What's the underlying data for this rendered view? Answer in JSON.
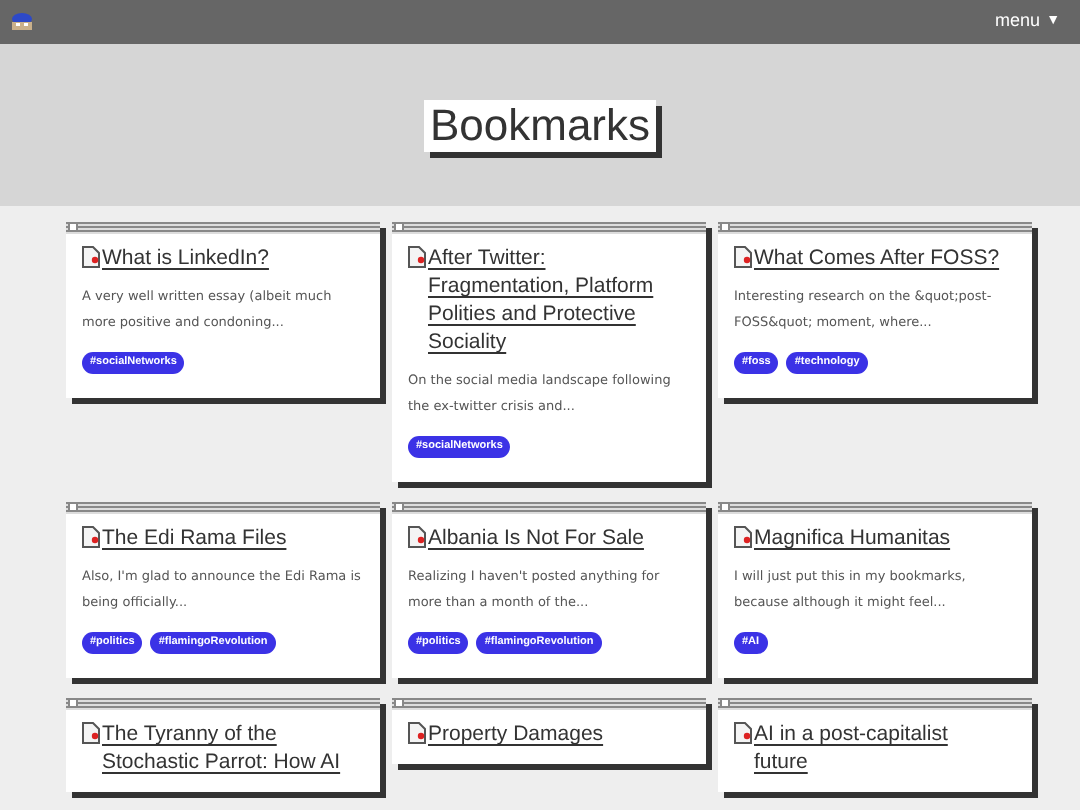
{
  "header": {
    "menu": "menu",
    "menu_caret": "▼"
  },
  "hero": {
    "title": "Bookmarks"
  },
  "bookmarks": [
    {
      "title": "What is LinkedIn?",
      "description": "A very well written essay (albeit much more positive and condoning...",
      "tags": [
        "#socialNetworks"
      ]
    },
    {
      "title": "After Twitter: Fragmentation, Platform Polities and Protective Sociality",
      "description": "On the social media landscape following the ex-twitter crisis and...",
      "tags": [
        "#socialNetworks"
      ]
    },
    {
      "title": "What Comes After FOSS?",
      "description": "Interesting research on the &quot;post-FOSS&quot; moment, where...",
      "tags": [
        "#foss",
        "#technology"
      ]
    },
    {
      "title": "The Edi Rama Files",
      "description": "Also, I'm glad to announce the Edi Rama is being officially...",
      "tags": [
        "#politics",
        "#flamingoRevolution"
      ]
    },
    {
      "title": "Albania Is Not For Sale",
      "description": "Realizing I haven't posted anything for more than a month of the...",
      "tags": [
        "#politics",
        "#flamingoRevolution"
      ]
    },
    {
      "title": "Magnifica Humanitas",
      "description": "I will just put this in my bookmarks, because although it might feel...",
      "tags": [
        "#AI"
      ]
    },
    {
      "title": "The Tyranny of the Stochastic Parrot: How AI"
    },
    {
      "title": "Property Damages"
    },
    {
      "title": "AI in a post-capitalist future"
    }
  ]
}
